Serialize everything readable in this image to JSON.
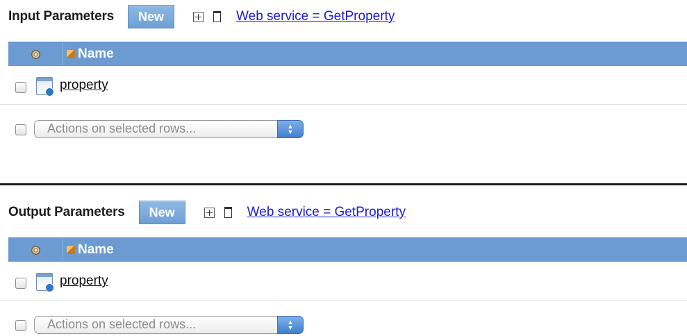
{
  "input_section": {
    "title": "Input Parameters",
    "new_label": "New",
    "link_text": "Web service = GetProperty",
    "grid": {
      "name_header": "Name",
      "rows": [
        {
          "name": "property"
        }
      ]
    },
    "actions_placeholder": "Actions on selected rows..."
  },
  "output_section": {
    "title": "Output Parameters",
    "new_label": "New",
    "link_text": "Web service = GetProperty",
    "grid": {
      "name_header": "Name",
      "rows": [
        {
          "name": "property"
        }
      ]
    },
    "actions_placeholder": "Actions on selected rows..."
  },
  "icons": {
    "expand": "expand-all-icon",
    "collapse": "collapse-all-icon",
    "settings": "gear-icon",
    "name_column": "cube-icon",
    "row_type": "web-parameter-icon",
    "select_arrow": "updown-arrows-icon"
  },
  "colors": {
    "header_blue": "#6b9bd0",
    "button_blue": "#7ea9da",
    "link_blue": "#1a1ad6"
  }
}
